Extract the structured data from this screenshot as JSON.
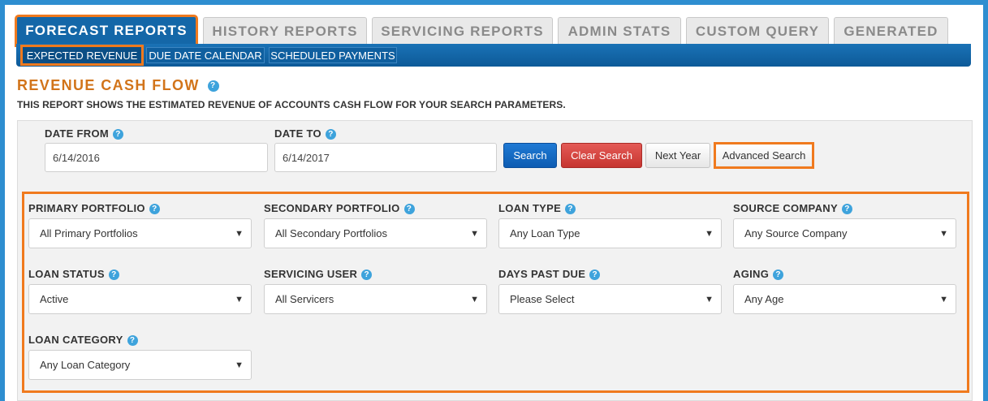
{
  "tabs": [
    {
      "label": "FORECAST REPORTS"
    },
    {
      "label": "HISTORY REPORTS"
    },
    {
      "label": "SERVICING REPORTS"
    },
    {
      "label": "ADMIN STATS"
    },
    {
      "label": "CUSTOM QUERY"
    },
    {
      "label": "GENERATED"
    }
  ],
  "subtabs": [
    {
      "label": "EXPECTED REVENUE"
    },
    {
      "label": "DUE DATE CALENDAR"
    },
    {
      "label": "SCHEDULED PAYMENTS"
    }
  ],
  "page": {
    "title": "REVENUE CASH FLOW",
    "description": "THIS REPORT SHOWS THE ESTIMATED REVENUE OF ACCOUNTS CASH FLOW FOR YOUR SEARCH PARAMETERS."
  },
  "search": {
    "date_from_label": "DATE FROM",
    "date_from_value": "6/14/2016",
    "date_to_label": "DATE TO",
    "date_to_value": "6/14/2017",
    "search_btn": "Search",
    "clear_btn": "Clear Search",
    "next_year_btn": "Next Year",
    "advanced_btn": "Advanced Search"
  },
  "filters": [
    {
      "label": "PRIMARY PORTFOLIO",
      "value": "All Primary Portfolios"
    },
    {
      "label": "SECONDARY PORTFOLIO",
      "value": "All Secondary Portfolios"
    },
    {
      "label": "LOAN TYPE",
      "value": "Any Loan Type"
    },
    {
      "label": "SOURCE COMPANY",
      "value": "Any Source Company"
    },
    {
      "label": "LOAN STATUS",
      "value": "Active"
    },
    {
      "label": "SERVICING USER",
      "value": "All Servicers"
    },
    {
      "label": "DAYS PAST DUE",
      "value": "Please Select"
    },
    {
      "label": "AGING",
      "value": "Any Age"
    },
    {
      "label": "LOAN CATEGORY",
      "value": "Any Loan Category"
    }
  ],
  "icons": {
    "help": "?",
    "dropdown": "▼"
  },
  "colors": {
    "accent": "#f07a1e",
    "nav": "#1467a8",
    "title": "#d2741a"
  }
}
